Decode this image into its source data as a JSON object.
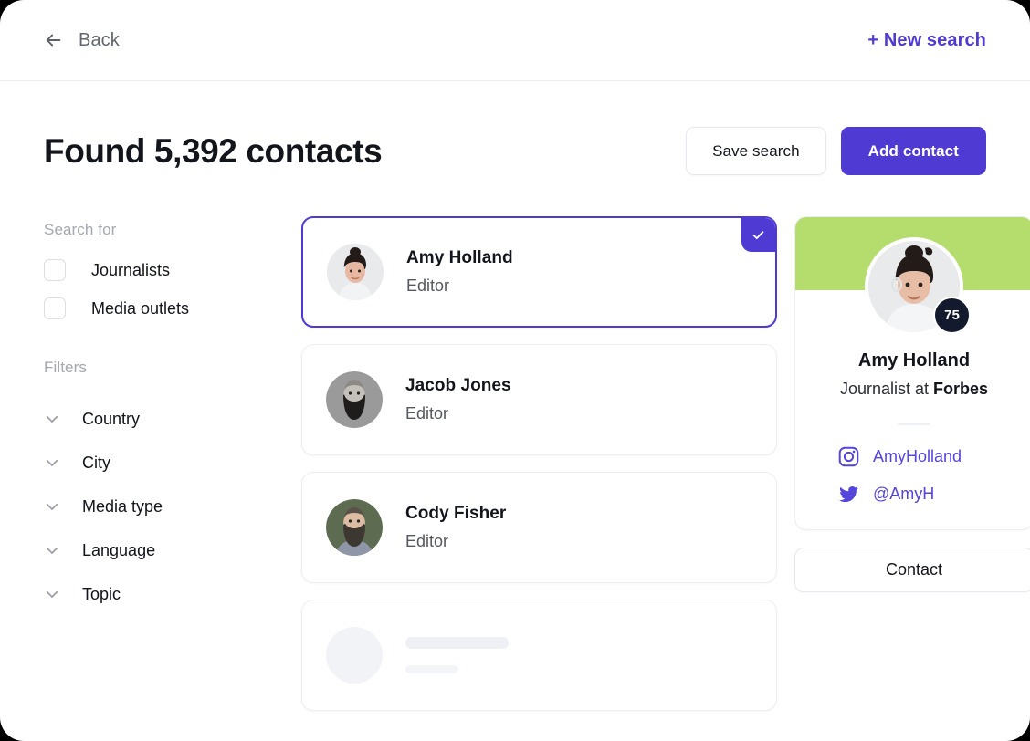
{
  "topbar": {
    "back_label": "Back",
    "back_icon": "arrow-left-icon",
    "new_search_label": "+ New search"
  },
  "header": {
    "title": "Found 5,392 contacts",
    "save_search_label": "Save search",
    "add_contact_label": "Add contact"
  },
  "sidebar": {
    "search_for_heading": "Search for",
    "checkboxes": [
      {
        "label": "Journalists",
        "checked": false
      },
      {
        "label": "Media outlets",
        "checked": false
      }
    ],
    "filters_heading": "Filters",
    "filters": [
      {
        "label": "Country",
        "icon": "chevron-down-icon"
      },
      {
        "label": "City",
        "icon": "chevron-down-icon"
      },
      {
        "label": "Media type",
        "icon": "chevron-down-icon"
      },
      {
        "label": "Language",
        "icon": "chevron-down-icon"
      },
      {
        "label": "Topic",
        "icon": "chevron-down-icon"
      }
    ]
  },
  "contacts": [
    {
      "name": "Amy Holland",
      "role": "Editor",
      "selected": true
    },
    {
      "name": "Jacob Jones",
      "role": "Editor",
      "selected": false
    },
    {
      "name": "Cody Fisher",
      "role": "Editor",
      "selected": false
    }
  ],
  "detail": {
    "score": "75",
    "name": "Amy Holland",
    "role_prefix": "Journalist at ",
    "outlet": "Forbes",
    "socials": [
      {
        "icon": "instagram-icon",
        "label": "AmyHolland"
      },
      {
        "icon": "twitter-icon",
        "label": "@AmyH"
      }
    ],
    "contact_button_label": "Contact"
  },
  "colors": {
    "accent_purple": "#4f3ad4",
    "banner_green": "#b5dd6e",
    "score_badge": "#141a2e",
    "text_primary": "#13151c",
    "text_muted": "#a5a8b0"
  }
}
